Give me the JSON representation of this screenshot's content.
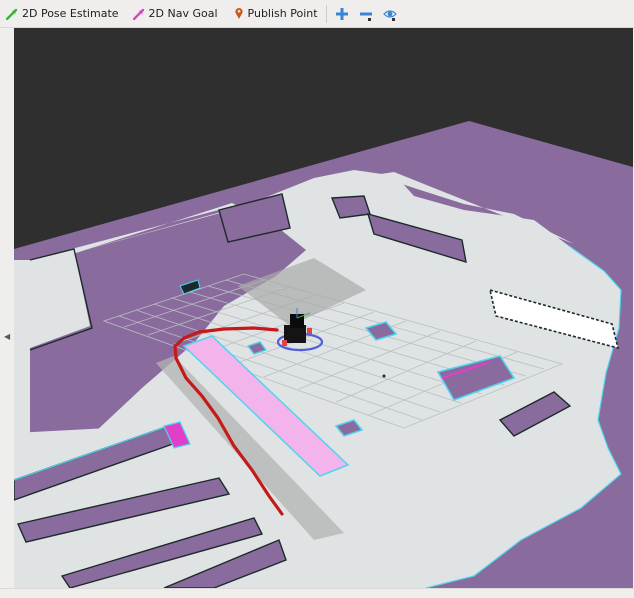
{
  "toolbar": {
    "pose_estimate_label": "2D Pose Estimate",
    "nav_goal_label": "2D Nav Goal",
    "publish_point_label": "Publish Point"
  },
  "icons": {
    "pose_estimate": "green-arrow-icon",
    "nav_goal": "magenta-arrow-icon",
    "publish_point": "map-pin-icon",
    "zoom_in": "plus-icon",
    "zoom_out": "minus-icon",
    "view": "eye-icon"
  },
  "colors": {
    "pose_estimate": "#3cb43c",
    "nav_goal": "#e040c8",
    "publish_point": "#c8551e",
    "map_unknown": "#8a6b9e",
    "map_free": "#dfe3e4",
    "background": "#2f2f2f",
    "path": "#c41a1a",
    "costmap": "#f2b4ea",
    "inflation": "#4fd4f0"
  }
}
